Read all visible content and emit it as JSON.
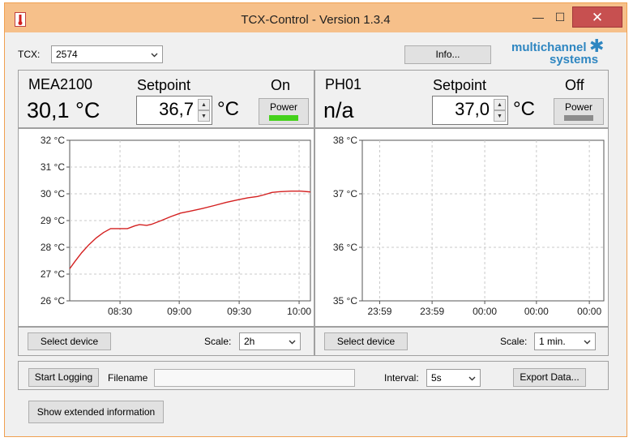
{
  "window": {
    "title": "TCX-Control - Version 1.3.4",
    "controls": {
      "minimize": "—",
      "maximize": "☐",
      "close": "✕"
    }
  },
  "toolbar": {
    "tcx_label": "TCX:",
    "tcx_value": "2574",
    "info_button": "Info...",
    "logo_line1": "multichannel",
    "logo_line2": "systems",
    "logo_mark": "✱"
  },
  "left": {
    "device": "MEA2100",
    "temperature": "30,1 °C",
    "setpoint_label": "Setpoint",
    "setpoint_value": "36,7",
    "unit": "°C",
    "state": "On",
    "power_label": "Power",
    "led_color": "#44d11b",
    "select_device": "Select device",
    "scale_label": "Scale:",
    "scale_value": "2h"
  },
  "right": {
    "device": "PH01",
    "temperature": "n/a",
    "setpoint_label": "Setpoint",
    "setpoint_value": "37,0",
    "unit": "°C",
    "state": "Off",
    "power_label": "Power",
    "led_color": "#8c8c8c",
    "select_device": "Select device",
    "scale_label": "Scale:",
    "scale_value": "1 min."
  },
  "logging": {
    "start_button": "Start Logging",
    "filename_label": "Filename",
    "filename_value": "",
    "interval_label": "Interval:",
    "interval_value": "5s",
    "export_button": "Export Data..."
  },
  "extended_button": "Show extended information",
  "chart_data": [
    {
      "type": "line",
      "y_ticks": [
        "32 °C",
        "31 °C",
        "30 °C",
        "29 °C",
        "28 °C",
        "27 °C",
        "26 °C"
      ],
      "x_ticks": [
        "08:30",
        "09:00",
        "09:30",
        "10:00"
      ],
      "ylim": [
        26,
        32
      ],
      "grid": true,
      "series": [
        {
          "color": "#d42020",
          "points": [
            [
              0,
              27.2
            ],
            [
              0.02,
              27.45
            ],
            [
              0.05,
              27.8
            ],
            [
              0.08,
              28.1
            ],
            [
              0.11,
              28.35
            ],
            [
              0.14,
              28.55
            ],
            [
              0.17,
              28.7
            ],
            [
              0.24,
              28.7
            ],
            [
              0.27,
              28.8
            ],
            [
              0.29,
              28.85
            ],
            [
              0.32,
              28.82
            ],
            [
              0.34,
              28.86
            ],
            [
              0.38,
              29.0
            ],
            [
              0.42,
              29.15
            ],
            [
              0.46,
              29.28
            ],
            [
              0.5,
              29.35
            ],
            [
              0.55,
              29.45
            ],
            [
              0.6,
              29.56
            ],
            [
              0.65,
              29.68
            ],
            [
              0.7,
              29.78
            ],
            [
              0.74,
              29.85
            ],
            [
              0.78,
              29.9
            ],
            [
              0.81,
              29.97
            ],
            [
              0.84,
              30.05
            ],
            [
              0.87,
              30.08
            ],
            [
              0.92,
              30.1
            ],
            [
              0.96,
              30.1
            ],
            [
              1.0,
              30.07
            ]
          ]
        }
      ]
    },
    {
      "type": "line",
      "y_ticks": [
        "38 °C",
        "37 °C",
        "36 °C",
        "35 °C"
      ],
      "x_ticks": [
        "23:59",
        "23:59",
        "00:00",
        "00:00",
        "00:00"
      ],
      "ylim": [
        35,
        38
      ],
      "grid": true,
      "series": []
    }
  ]
}
